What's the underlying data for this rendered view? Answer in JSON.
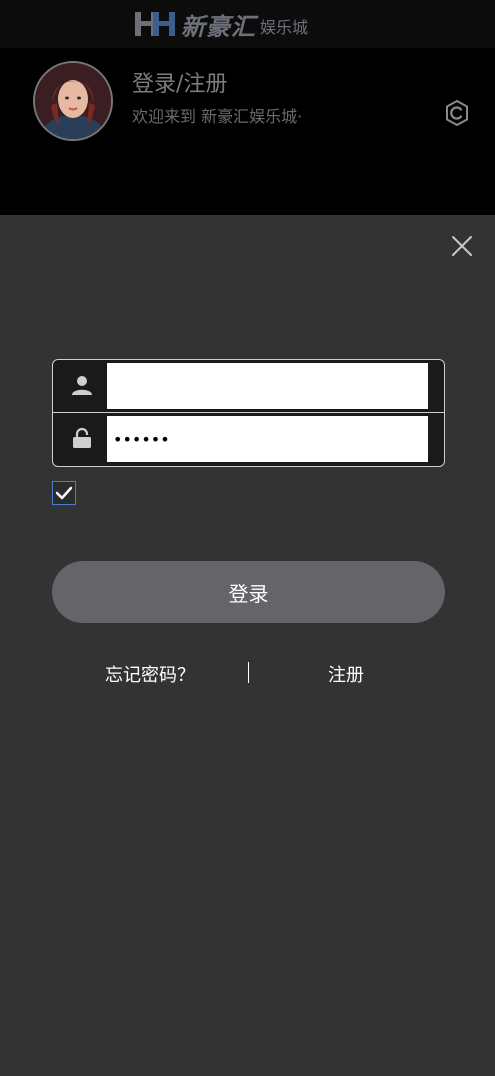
{
  "header": {
    "logo_mark": "HH",
    "logo_main": "新豪汇",
    "logo_sub": "娱乐城"
  },
  "profile": {
    "title": "登录/注册",
    "subtitle": "欢迎来到 新豪汇娱乐城·"
  },
  "login_form": {
    "username_value": "",
    "password_value": "••••••",
    "remember_checked": true,
    "login_label": "登录",
    "forgot_label": "忘记密码？",
    "separator": "|",
    "register_label": "注册"
  },
  "icons": {
    "settings": "gear-icon",
    "close": "close-icon",
    "user": "user-icon",
    "lock": "lock-icon",
    "check": "check-icon"
  }
}
